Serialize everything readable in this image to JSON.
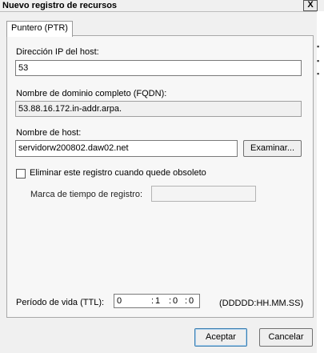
{
  "window": {
    "title": "Nuevo registro de recursos",
    "close_label": "X"
  },
  "tab": {
    "label": "Puntero (PTR)"
  },
  "fields": {
    "ip_label": "Dirección IP del host:",
    "ip_value": "53",
    "fqdn_label": "Nombre de dominio completo (FQDN):",
    "fqdn_value": "53.88.16.172.in-addr.arpa.",
    "host_label": "Nombre de host:",
    "host_value": "servidorw200802.daw02.net",
    "browse_label": "Examinar...",
    "delete_checkbox_label": "Eliminar este registro cuando quede obsoleto",
    "timestamp_label": "Marca de tiempo de registro:",
    "timestamp_value": ""
  },
  "ttl": {
    "label": "Período de vida (TTL):",
    "days": "0",
    "hours": "1",
    "minutes": "0",
    "seconds": "0",
    "format": "(DDDDD:HH.MM.SS)"
  },
  "buttons": {
    "ok": "Aceptar",
    "cancel": "Cancelar"
  }
}
